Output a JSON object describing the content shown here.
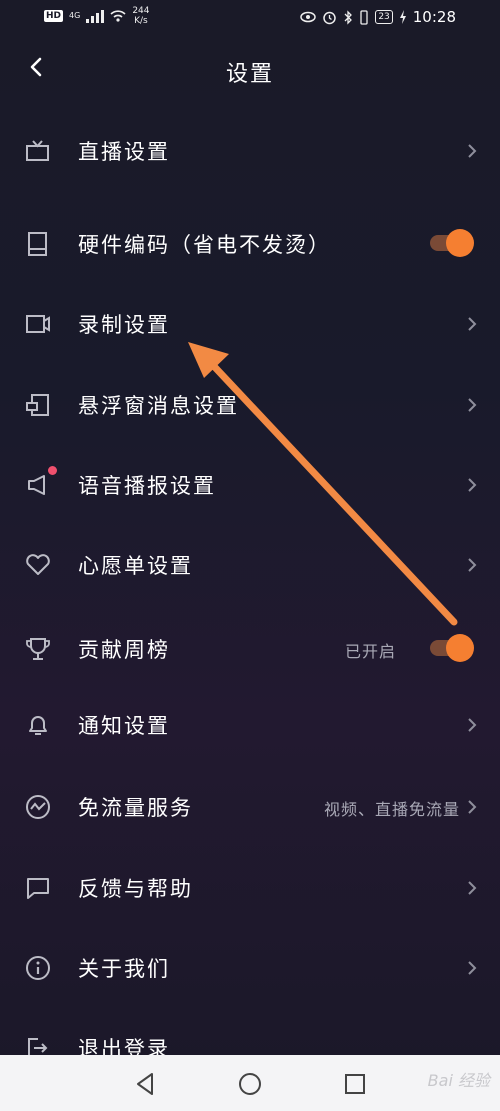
{
  "status_bar": {
    "hd": "HD",
    "network": "4G",
    "speed": "244",
    "speed_unit": "K/s",
    "battery": "23",
    "time": "10:28"
  },
  "header": {
    "title": "设置"
  },
  "settings": [
    {
      "label": "直播设置",
      "icon": "tv-icon",
      "control": "chevron"
    },
    {
      "label": "硬件编码（省电不发烫）",
      "icon": "tablet-icon",
      "control": "toggle",
      "on": true
    },
    {
      "label": "录制设置",
      "icon": "video-camera-icon",
      "control": "chevron"
    },
    {
      "label": "悬浮窗消息设置",
      "icon": "floating-window-icon",
      "control": "chevron"
    },
    {
      "label": "语音播报设置",
      "icon": "speaker-icon",
      "control": "chevron",
      "badge": true
    },
    {
      "label": "心愿单设置",
      "icon": "heart-icon",
      "control": "chevron"
    },
    {
      "label": "贡献周榜",
      "icon": "trophy-icon",
      "control": "toggle",
      "on": true,
      "value": "已开启"
    },
    {
      "label": "通知设置",
      "icon": "bell-icon",
      "control": "chevron"
    },
    {
      "label": "免流量服务",
      "icon": "pulse-icon",
      "control": "chevron",
      "value": "视频、直播免流量"
    },
    {
      "label": "反馈与帮助",
      "icon": "message-icon",
      "control": "chevron"
    },
    {
      "label": "关于我们",
      "icon": "info-icon",
      "control": "chevron"
    },
    {
      "label": "退出登录",
      "icon": "logout-icon",
      "control": "none"
    }
  ],
  "colors": {
    "accent": "#f57f31",
    "annotation_arrow": "#f28a44",
    "badge": "#f0506e"
  },
  "nav_bar": {
    "watermark": "Bai 经验"
  }
}
